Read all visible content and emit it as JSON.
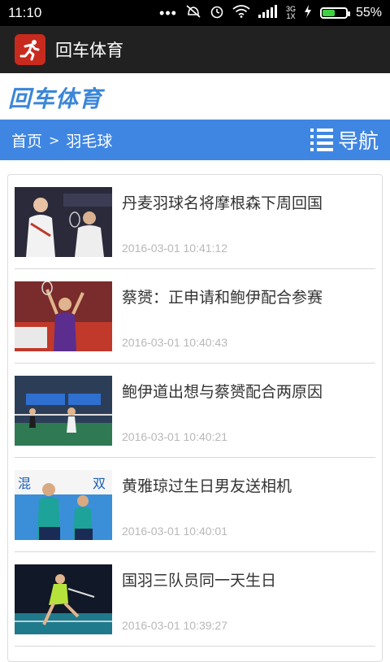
{
  "status_bar": {
    "time": "11:10",
    "dots": "•••",
    "network_top": "3G",
    "network_bottom": "1X",
    "battery_percent": "55%",
    "battery_level": 0.55
  },
  "app_bar": {
    "title": "回车体育"
  },
  "brand": {
    "text": "回车体育"
  },
  "nav": {
    "breadcrumb_home": "首页",
    "breadcrumb_separator": ">",
    "breadcrumb_current": "羽毛球",
    "menu_label": "导航"
  },
  "articles": [
    {
      "title": "丹麦羽球名将摩根森下周回国",
      "date": "2016-03-01 10:41:12"
    },
    {
      "title": "蔡赟：正申请和鲍伊配合参赛",
      "date": "2016-03-01 10:40:43"
    },
    {
      "title": "鲍伊道出想与蔡赟配合两原因",
      "date": "2016-03-01 10:40:21"
    },
    {
      "title": "黄雅琼过生日男友送相机",
      "date": "2016-03-01 10:40:01"
    },
    {
      "title": "国羽三队员同一天生日",
      "date": "2016-03-01 10:39:27"
    }
  ],
  "colors": {
    "nav_blue": "#3f86e2",
    "brand_blue": "#3b86d8",
    "app_bar": "#212121",
    "app_icon_red": "#c92a1e"
  }
}
